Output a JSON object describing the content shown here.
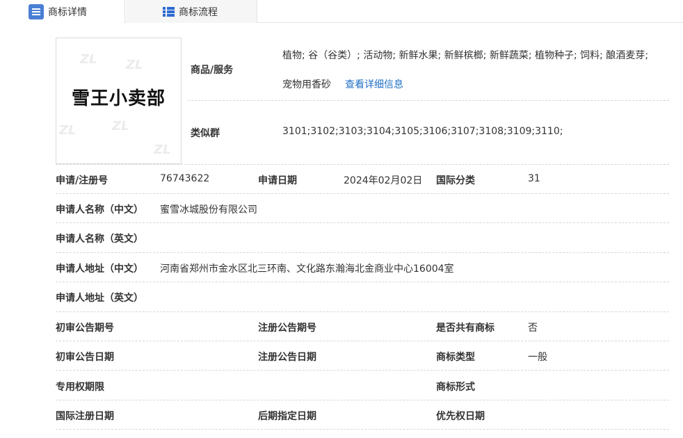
{
  "tabs": {
    "detail": "商标详情",
    "flow": "商标流程"
  },
  "logo": {
    "text": "雪王小卖部"
  },
  "goods": {
    "label": "商品/服务",
    "line1": "植物; 谷（谷类）; 活动物; 新鲜水果; 新鲜槟榔; 新鲜蔬菜; 植物种子; 饲料; 酿酒麦芽;",
    "line2": "宠物用香砂",
    "more_link": "查看详细信息"
  },
  "similar": {
    "label": "类似群",
    "value": "3101;3102;3103;3104;3105;3106;3107;3108;3109;3110;"
  },
  "fields": {
    "reg_no_label": "申请/注册号",
    "reg_no": "76743622",
    "app_date_label": "申请日期",
    "app_date": "2024年02月02日",
    "intl_class_label": "国际分类",
    "intl_class": "31",
    "applicant_cn_label": "申请人名称（中文）",
    "applicant_cn": "蜜雪冰城股份有限公司",
    "applicant_en_label": "申请人名称（英文）",
    "address_cn_label": "申请人地址（中文）",
    "address_cn": "河南省郑州市金水区北三环南、文化路东瀚海北金商业中心16004室",
    "address_en_label": "申请人地址（英文）",
    "prelim_no_label": "初审公告期号",
    "reg_pub_no_label": "注册公告期号",
    "shared_label": "是否共有商标",
    "shared": "否",
    "prelim_date_label": "初审公告日期",
    "reg_pub_date_label": "注册公告日期",
    "tm_type_label": "商标类型",
    "tm_type": "一般",
    "exclusive_label": "专用权期限",
    "tm_form_label": "商标形式",
    "intl_reg_date_label": "国际注册日期",
    "later_date_label": "后期指定日期",
    "priority_date_label": "优先权日期"
  }
}
